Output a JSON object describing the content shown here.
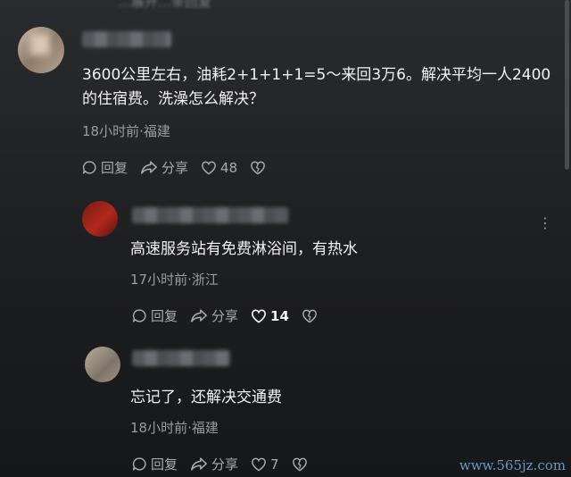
{
  "top_partial_text": "…展开…条回复",
  "comments": [
    {
      "text": "3600公里左右，油耗2+1+1+1=5～来回3万6。解决平均一人2400的住宿费。洗澡怎么解决？",
      "meta": "18小时前·福建",
      "reply_label": "回复",
      "share_label": "分享",
      "like_count": "48"
    },
    {
      "text": "高速服务站有免费淋浴间，有热水",
      "meta": "17小时前·浙江",
      "reply_label": "回复",
      "share_label": "分享",
      "like_count": "14"
    },
    {
      "text": "忘记了，还解决交通费",
      "meta": "18小时前·福建",
      "reply_label": "回复",
      "share_label": "分享",
      "like_count": "7"
    }
  ],
  "more_menu": "⋮",
  "watermark": "www.565jz.com",
  "icons": {
    "reply": "reply-icon",
    "share": "share-icon",
    "like": "heart-icon",
    "dislike": "broken-heart-icon"
  }
}
